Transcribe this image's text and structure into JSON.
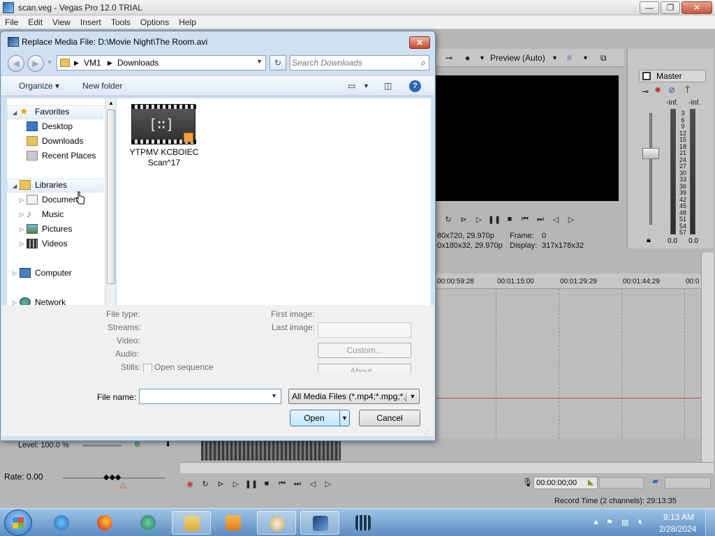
{
  "app": {
    "title": "scan.veg - Vegas Pro 12.0 TRIAL",
    "menu": [
      "File",
      "Edit",
      "View",
      "Insert",
      "Tools",
      "Options",
      "Help"
    ],
    "window_buttons": {
      "minimize": "—",
      "maximize": "❐",
      "close": "✕"
    }
  },
  "preview": {
    "mode": "Preview (Auto)",
    "project_info": "80x720, 29.970p",
    "preview_info": "0x180x32, 29.970p",
    "frame_label": "Frame:",
    "frame_value": "0",
    "display_label": "Display:",
    "display_value": "317x178x32"
  },
  "master": {
    "label": "Master",
    "left_peak": "-Inf.",
    "right_peak": "-Inf.",
    "scale": [
      "3",
      "6",
      "9",
      "12",
      "15",
      "18",
      "21",
      "24",
      "27",
      "30",
      "33",
      "36",
      "39",
      "42",
      "45",
      "48",
      "51",
      "54",
      "57"
    ],
    "left_value": "0.0",
    "right_value": "0.0"
  },
  "timeline": {
    "ticks": [
      "00:00:59:28",
      "00:01:15:00",
      "00:01:29:29",
      "00:01:44:29",
      "00:0"
    ],
    "level": "Level: 100.0 %",
    "rate": "Rate: 0.00",
    "timecode": "00:00:00;00",
    "record_time": "Record Time (2 channels): 29:13:35"
  },
  "dialog": {
    "title": "Replace Media File: D:\\Movie Night\\The Room.avi",
    "close": "✕",
    "nav": {
      "back": "◀",
      "forward": "▶"
    },
    "address": {
      "root": "VM1",
      "sep": "▶",
      "folder": "Downloads",
      "drop": "▼"
    },
    "refresh": "↻",
    "search": {
      "placeholder": "Search Downloads",
      "icon": "search-icon"
    },
    "toolbar": {
      "organize": "Organize ▾",
      "new_folder": "New folder",
      "help": "?"
    },
    "tree": {
      "favorites": "Favorites",
      "desktop": "Desktop",
      "downloads": "Downloads",
      "recent": "Recent Places",
      "libraries": "Libraries",
      "documents": "Documents",
      "music": "Music",
      "pictures": "Pictures",
      "videos": "Videos",
      "computer": "Computer",
      "network": "Network"
    },
    "file": {
      "name_line1": "YTPMV KCBOIEC",
      "name_line2": "Scan^17",
      "thumb_text": "[∷]"
    },
    "details": {
      "file_type": "File type:",
      "streams": "Streams:",
      "video": "Video:",
      "audio": "Audio:",
      "stills": "Stills:",
      "open_sequence": "Open sequence",
      "first_image": "First image:",
      "last_image": "Last image:",
      "custom": "Custom...",
      "about": "About..."
    },
    "bottom": {
      "file_name_label": "File name:",
      "file_name_value": "",
      "filter": "All Media Files (*.mp4;*.mpg;*.j",
      "open": "Open",
      "cancel": "Cancel",
      "drop": "▼"
    }
  },
  "taskbar": {
    "time": "9:13 AM",
    "date": "2/28/2024",
    "tray_expand": "▲"
  }
}
